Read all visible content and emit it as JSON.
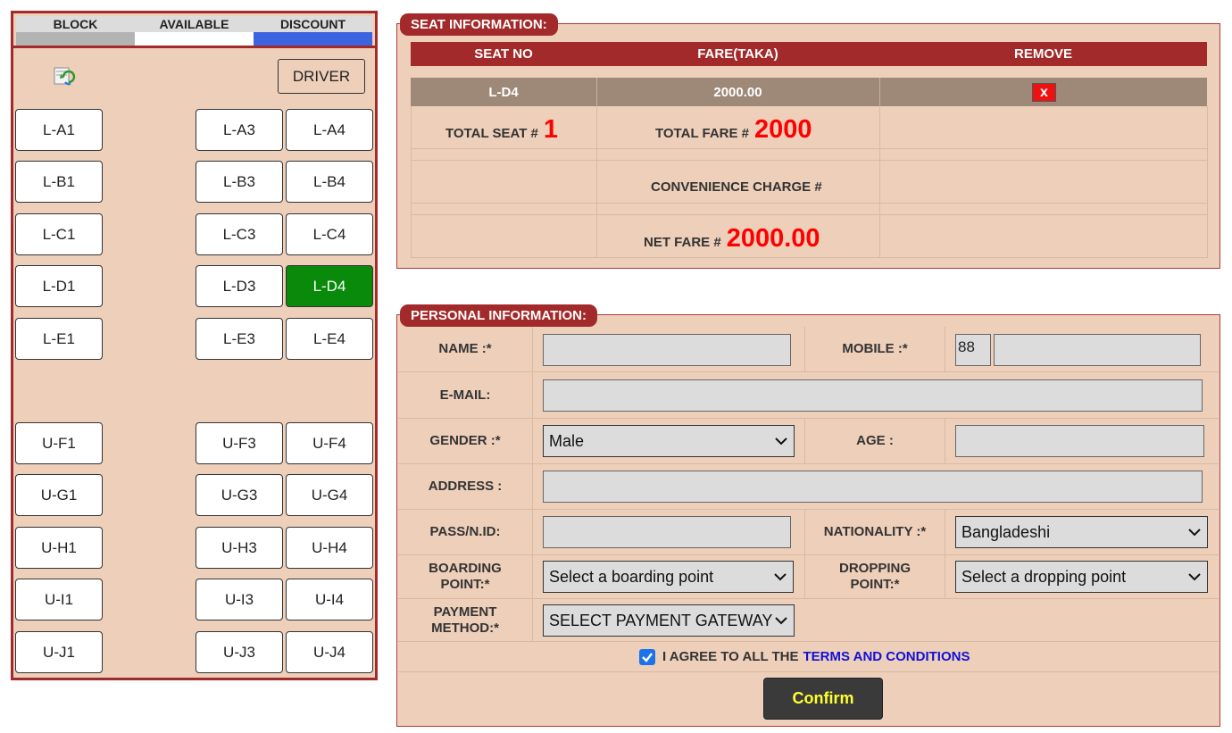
{
  "legend": {
    "block": "BLOCK",
    "available": "AVAILABLE",
    "discount": "DISCOUNT",
    "colors": {
      "block": "#b3b3b3",
      "available": "#ffffff",
      "discount": "#3c63e0"
    }
  },
  "seatmap": {
    "refresh_icon": "refresh-icon",
    "driver_label": "DRIVER",
    "seats": [
      "L-A1",
      "L-A3",
      "L-A4",
      "L-B1",
      "L-B3",
      "L-B4",
      "L-C1",
      "L-C3",
      "L-C4",
      "L-D1",
      "L-D3",
      "L-D4",
      "L-E1",
      "L-E3",
      "L-E4",
      "U-F1",
      "U-F3",
      "U-F4",
      "U-G1",
      "U-G3",
      "U-G4",
      "U-H1",
      "U-H3",
      "U-H4",
      "U-I1",
      "U-I3",
      "U-I4",
      "U-J1",
      "U-J3",
      "U-J4"
    ],
    "selected_seat": "L-D4"
  },
  "seat_info": {
    "title": "SEAT INFORMATION:",
    "headers": [
      "SEAT NO",
      "FARE(TAKA)",
      "REMOVE"
    ],
    "row": {
      "seat": "L-D4",
      "fare": "2000.00",
      "remove": "x"
    },
    "total_seat_label": "TOTAL SEAT #",
    "total_seat_value": "1",
    "total_fare_label": "TOTAL FARE #",
    "total_fare_value": "2000",
    "convenience_label": "CONVENIENCE CHARGE #",
    "net_fare_label": "NET FARE #",
    "net_fare_value": "2000.00"
  },
  "personal_info": {
    "title": "PERSONAL INFORMATION:",
    "name_label": "NAME :*",
    "name_value": "",
    "mobile_label": "MOBILE :*",
    "mobile_prefix": "88",
    "mobile_value": "",
    "email_label": "E-MAIL:",
    "email_value": "",
    "gender_label": "GENDER :*",
    "gender_value": "Male",
    "age_label": "AGE :",
    "age_value": "",
    "address_label": "ADDRESS :",
    "address_value": "",
    "passport_label": "PASS/N.ID:",
    "passport_value": "",
    "nationality_label": "NATIONALITY :*",
    "nationality_value": "Bangladeshi",
    "boarding_label_1": "BOARDING",
    "boarding_label_2": "POINT:*",
    "boarding_value": "Select a boarding point",
    "dropping_label_1": "DROPPING",
    "dropping_label_2": "POINT:*",
    "dropping_value": "Select a dropping point",
    "payment_label_1": "PAYMENT",
    "payment_label_2": "METHOD:*",
    "payment_value": "SELECT PAYMENT GATEWAY",
    "agree_text": "I AGREE TO ALL THE",
    "terms_link": "TERMS AND CONDITIONS",
    "agree_checked": true,
    "confirm_label": "Confirm"
  }
}
